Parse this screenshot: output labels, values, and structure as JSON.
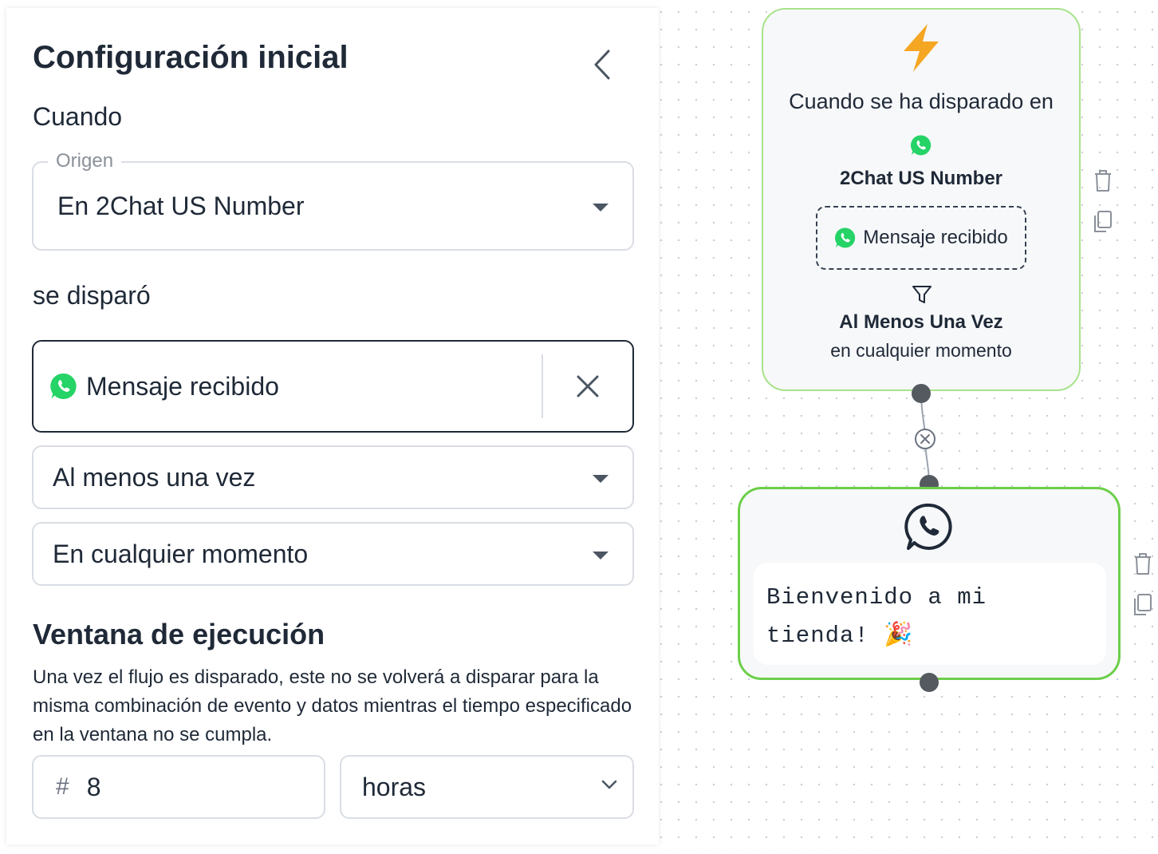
{
  "panel": {
    "title": "Configuración inicial",
    "when_label": "Cuando",
    "origin": {
      "legend": "Origen",
      "value": "En 2Chat US Number"
    },
    "fired_label": "se disparó",
    "event": {
      "value": "Mensaje recibido",
      "icon": "whatsapp-icon"
    },
    "frequency": {
      "value": "Al menos una vez"
    },
    "time": {
      "value": "En cualquier momento"
    },
    "window_title": "Ventana de ejecución",
    "window_description": "Una vez el flujo es disparado, este no se volverá a disparar para la misma combinación de evento y datos mientras el tiempo especificado en la ventana no se cumpla.",
    "window_amount": "8",
    "window_unit": "horas"
  },
  "canvas": {
    "trigger_node": {
      "icon": "lightning-icon",
      "title": "Cuando se ha disparado en",
      "source": "2Chat US Number",
      "event": "Mensaje recibido",
      "frequency": "Al Menos Una Vez",
      "time": "en cualquier momento"
    },
    "message_node": {
      "icon": "whatsapp-icon",
      "message": "Bienvenido a mi tienda! 🎉"
    }
  },
  "colors": {
    "trigger_border": "#a7e38a",
    "message_border": "#6ccf49",
    "whatsapp_green": "#25D366",
    "bolt_orange": "#F5A623"
  }
}
